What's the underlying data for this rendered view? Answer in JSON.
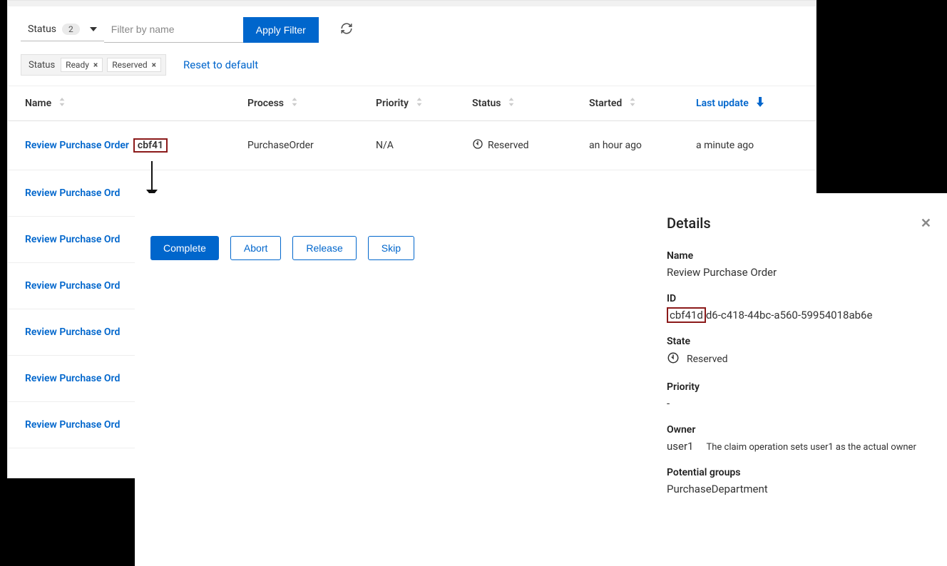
{
  "filter": {
    "status_label": "Status",
    "status_count": "2",
    "name_placeholder": "Filter by name",
    "apply_label": "Apply Filter"
  },
  "chips": {
    "group_label": "Status",
    "chip1": "Ready",
    "chip2": "Reserved",
    "reset": "Reset to default"
  },
  "columns": {
    "name": "Name",
    "process": "Process",
    "priority": "Priority",
    "status": "Status",
    "started": "Started",
    "last": "Last update"
  },
  "row1": {
    "name_prefix": "Review Purchase Order",
    "name_hl": "cbf41",
    "process": "PurchaseOrder",
    "priority": "N/A",
    "status": "Reserved",
    "started": "an hour ago",
    "last": "a minute ago"
  },
  "rows_rest": {
    "r2": "Review Purchase Ord",
    "r3": "Review Purchase Ord",
    "r4": "Review Purchase Ord",
    "r5": "Review Purchase Ord",
    "r6": "Review Purchase Ord",
    "r7": "Review Purchase Ord"
  },
  "actions": {
    "complete": "Complete",
    "abort": "Abort",
    "release": "Release",
    "skip": "Skip"
  },
  "details": {
    "title": "Details",
    "name_label": "Name",
    "name_value": "Review Purchase Order",
    "id_label": "ID",
    "id_hl": "cbf41d",
    "id_rest": "d6-c418-44bc-a560-59954018ab6e",
    "state_label": "State",
    "state_value": "Reserved",
    "priority_label": "Priority",
    "priority_value": "-",
    "owner_label": "Owner",
    "owner_value": "user1",
    "owner_annot": "The claim operation sets user1 as the actual owner",
    "groups_label": "Potential groups",
    "groups_value": "PurchaseDepartment"
  }
}
